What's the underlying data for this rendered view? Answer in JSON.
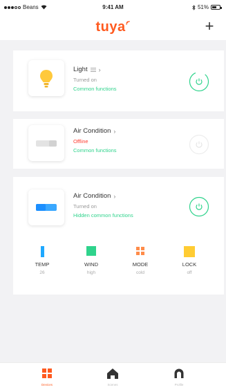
{
  "status_bar": {
    "carrier": "Beans",
    "time": "9:41 AM",
    "battery": "51%"
  },
  "header": {
    "logo": "tuya",
    "add_label": "+"
  },
  "devices": [
    {
      "name": "Light",
      "status": "Turned on",
      "link": "Common functions",
      "icon": "bulb-icon",
      "power_color": "#2fd38c"
    },
    {
      "name": "Air Condition",
      "status": "Offline",
      "link": "Common functions",
      "icon": "ac-unit-icon",
      "power_color": "#dddddd"
    },
    {
      "name": "Air Condition",
      "status": "Turned on",
      "link": "Hidden common functions",
      "icon": "ac-unit-icon",
      "power_color": "#2fd38c",
      "controls": [
        {
          "label": "TEMP",
          "value": "26",
          "icon": "temp-icon",
          "color": "#1ea8ff"
        },
        {
          "label": "WIND",
          "value": "high",
          "icon": "wind-icon",
          "color": "#2fd38c"
        },
        {
          "label": "MODE",
          "value": "cold",
          "icon": "mode-icon",
          "color": "#ff8c4a"
        },
        {
          "label": "LOCK",
          "value": "off",
          "icon": "lock-icon",
          "color": "#ffcc33"
        }
      ]
    }
  ],
  "tabs": [
    {
      "label": "Devices",
      "icon": "devices-icon",
      "active": true
    },
    {
      "label": "Scenes",
      "icon": "home-icon",
      "active": false
    },
    {
      "label": "Profile",
      "icon": "profile-icon",
      "active": false
    }
  ],
  "colors": {
    "brand": "#ff5a1f",
    "accent_green": "#2fd38c",
    "offline_red": "#ff3b30",
    "background": "#f2f2f4"
  }
}
